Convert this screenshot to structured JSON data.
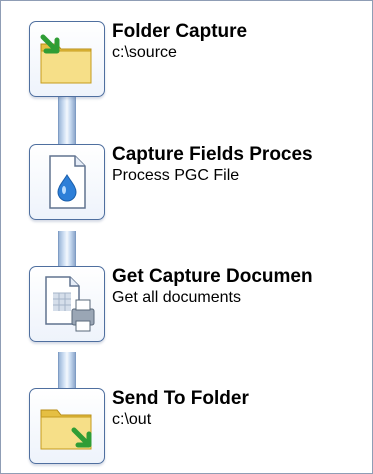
{
  "workflow": {
    "steps": [
      {
        "title": "Folder Capture",
        "subtitle": "c:\\source",
        "icon": "folder-capture-icon"
      },
      {
        "title": "Capture Fields Proces",
        "subtitle": "Process PGC File",
        "icon": "document-drop-icon"
      },
      {
        "title": "Get Capture Documen",
        "subtitle": "Get all documents",
        "icon": "document-printer-icon"
      },
      {
        "title": "Send To Folder",
        "subtitle": "c:\\out",
        "icon": "folder-send-icon"
      }
    ]
  },
  "colors": {
    "connector": "#c9dbf1",
    "tile_border": "#4f6f9f",
    "folder": "#f1d36a",
    "arrow": "#2f9d35"
  }
}
